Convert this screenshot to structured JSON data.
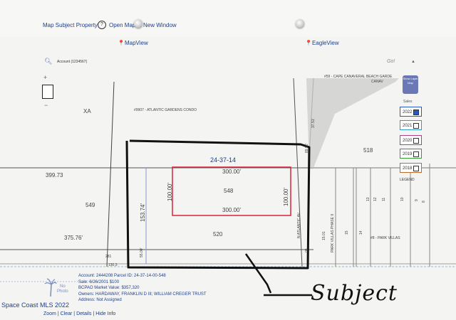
{
  "header": {
    "map_subject_link": "Map Subject Property",
    "open_map_link": "Open Map in New Window",
    "help_icon_glyph": "?"
  },
  "tabs": {
    "mapview": "MapView",
    "eagleview": "EagleView"
  },
  "search": {
    "placeholder": "Account (1234567)",
    "go_label": "Go!"
  },
  "map": {
    "labels": {
      "xa": "XA",
      "atlantic_gardens": "#9907 - ATLANTIC GARDENS CONDO",
      "cape_canaveral": "#59 - CAPE CANAVERAL BEACH GARDE",
      "cape_sub": "CANAV",
      "dim_89_96": "89.96'",
      "dim_37_51": "37.51'",
      "num_518": "518",
      "grid_id": "24-37-14",
      "dim_300_top": "300.00'",
      "dim_300_bot": "300.00'",
      "num_548": "548",
      "dim_100_left": "100.00'",
      "dim_100_right": "100.00'",
      "dim_399_73": "399.73",
      "num_549": "549",
      "dim_153_74": "153.74'",
      "dim_375_76": "375.76'",
      "num_520": "520",
      "street": "N ATLANTIC AV",
      "dim_55": "55.00'",
      "num_281": "281",
      "dim_130": "130.3",
      "dim_15_01": "15.01",
      "park_villas_phase": "PARK VILLAS PHASE II",
      "num_15": "15",
      "num_14": "14",
      "num_13": "13",
      "num_12": "12",
      "num_11": "11",
      "num_10": "10",
      "num_9": "9",
      "num_8": "8",
      "park_villas": "#8 - PARK VILLAS",
      "num_05": "05"
    }
  },
  "sidebar": {
    "show_layer": "Show Layer Map",
    "sales_label": "Sales",
    "years": [
      {
        "year": "2022",
        "checked": true
      },
      {
        "year": "2021",
        "checked": false
      },
      {
        "year": "2020",
        "checked": false
      },
      {
        "year": "2019",
        "checked": false
      },
      {
        "year": "2018",
        "checked": false
      }
    ],
    "legend": "LEGEND"
  },
  "info": {
    "account": "Account: 2444208  Parcel ID: 24-37-14-00-548",
    "sale": "Sale: 6/26/2001 $100",
    "market_value": "BCPAO Market Value: $357,320",
    "owners": "Owners: HARDAWAY, FRANKLIN D III; WILLIAM CREGER TRUST",
    "address": "Address: Not Assigned"
  },
  "no_photo": "No\nPhoto",
  "watermark": "Space Coast MLS 2022",
  "bottom": {
    "zoom": "Zoom",
    "clear": "Clear",
    "details": "Details",
    "hide_info": "Hide Info"
  },
  "annotation": {
    "subject": "Subject"
  },
  "colors": {
    "link_blue": "#1f3f8a",
    "parcel_red": "#e0203a",
    "marker_black": "#111111",
    "check_blue": "#2a56c6"
  }
}
